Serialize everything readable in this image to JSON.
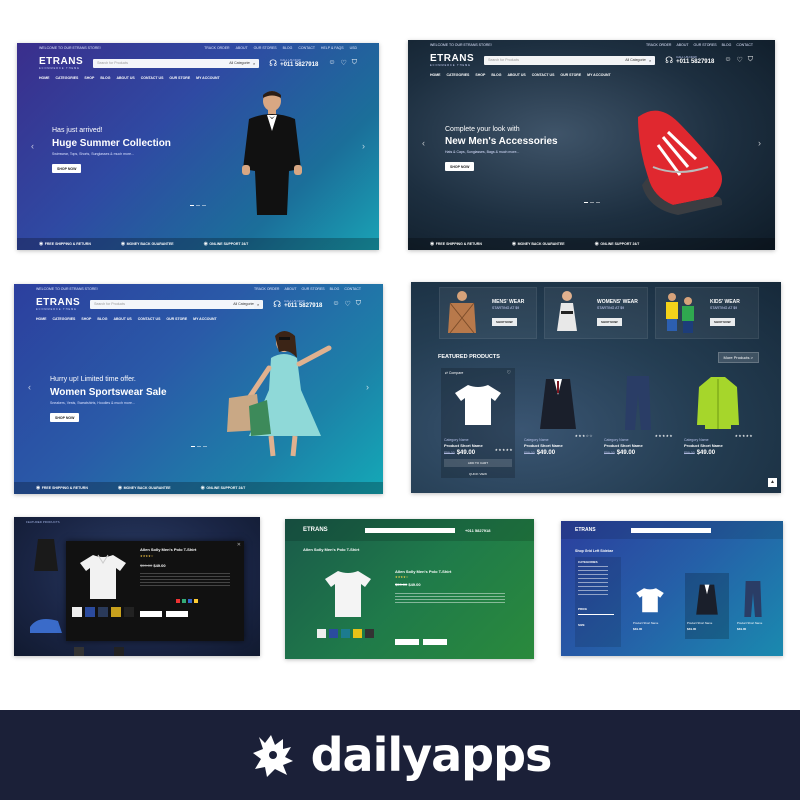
{
  "store": {
    "welcome": "WELCOME TO OUR ETRANS STORE!",
    "top_links": [
      "Track Order",
      "About",
      "Our Stores",
      "Blog",
      "Contact",
      "Help & FAQs",
      "USD",
      "f",
      "t",
      "in"
    ],
    "logo": "ETRANS",
    "logo_tagline": "ECOMMERCE THEME",
    "search_placeholder": "Search for Products",
    "search_category": "All Categories",
    "call_label": "CALL US NOW",
    "phone": "+011 5827918",
    "nav": [
      "HOME",
      "CATEGORIES",
      "SHOP",
      "BLOG",
      "ABOUT US",
      "CONTACT US",
      "OUR STORE",
      "MY ACCOUNT"
    ],
    "features": [
      "FREE SHIPPING & RETURN",
      "MONEY BACK GUARANTEE",
      "ONLINE SUPPORT 24/7"
    ]
  },
  "slides": [
    {
      "sub": "Has just arrived!",
      "title": "Huge Summer Collection",
      "desc": "Swimwear, Tops, Shorts, Sunglasses & much more...",
      "button": "SHOP NOW"
    },
    {
      "sub": "Complete your look with",
      "title": "New Men's Accessories",
      "desc": "Hats & Caps, Sunglasses, Bags & much more...",
      "button": "SHOP NOW"
    },
    {
      "sub": "Hurry up! Limited time offer.",
      "title": "Women Sportswear Sale",
      "desc": "Sneakers, Vests, Sweatshirts, Hoodies & much more...",
      "button": "SHOP NOW"
    }
  ],
  "categories": [
    {
      "name": "MENS' WEAR",
      "starting": "STARTING AT $9",
      "button": "SHOP NOW"
    },
    {
      "name": "WOMENS' WEAR",
      "starting": "STARTING AT $9",
      "button": "SHOP NOW"
    },
    {
      "name": "KIDS' WEAR",
      "starting": "STARTING AT $9",
      "button": "SHOP NOW"
    }
  ],
  "featured": {
    "title": "FEATURED PRODUCTS",
    "more": "More Products >",
    "compare": "Compare",
    "add_to_cart": "ADD TO CART",
    "quick_view": "QUICK VIEW",
    "products": [
      {
        "category": "Category Name",
        "name": "Product Short Name",
        "old": "$59.00",
        "price": "$49.00"
      },
      {
        "category": "Category Name",
        "name": "Product Short Name",
        "old": "$59.00",
        "price": "$49.00"
      },
      {
        "category": "Category Name",
        "name": "Product Short Name",
        "old": "$59.00",
        "price": "$49.00"
      },
      {
        "category": "Category Name",
        "name": "Product Short Name",
        "old": "$59.00",
        "price": "$49.00"
      }
    ]
  },
  "quickview": {
    "section": "FEATURED PRODUCTS",
    "title": "Allen Solly Men's Polo T-Shirt",
    "old": "$59.00",
    "price": "$49.00"
  },
  "product_page": {
    "title": "Allen Solly Men's Polo T-Shirt",
    "old": "$59.00",
    "price": "$49.00"
  },
  "shop_grid": {
    "title": "Shop Grid Left Sidebar",
    "categories_label": "CATEGORIES",
    "price_label": "PRICE",
    "size_label": "SIZE",
    "product_name": "Product Short Name",
    "price": "$49.00"
  },
  "footer": {
    "brand": "dailyapps"
  }
}
